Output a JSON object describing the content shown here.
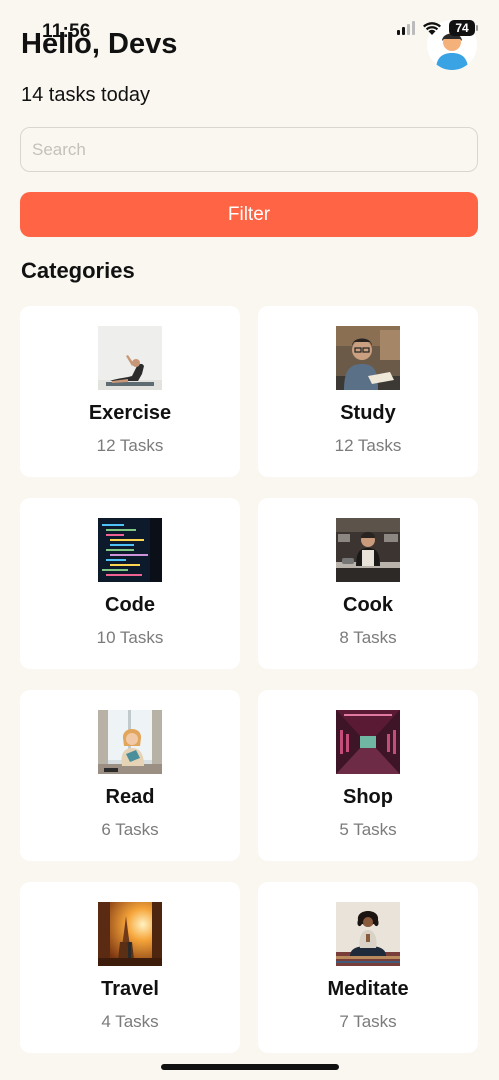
{
  "status_bar": {
    "time": "11:56",
    "battery": "74"
  },
  "header": {
    "greeting": "Hello, Devs",
    "subtitle": "14 tasks today"
  },
  "search": {
    "placeholder": "Search",
    "value": ""
  },
  "filter": {
    "label": "Filter",
    "color": "#ff6445"
  },
  "categories": {
    "title": "Categories",
    "items": [
      {
        "name": "Exercise",
        "count": "12 Tasks",
        "image": "yoga-stretch-photo"
      },
      {
        "name": "Study",
        "count": "12 Tasks",
        "image": "man-reading-book-photo"
      },
      {
        "name": "Code",
        "count": "10 Tasks",
        "image": "code-on-screen-photo"
      },
      {
        "name": "Cook",
        "count": "8 Tasks",
        "image": "chef-kitchen-photo"
      },
      {
        "name": "Read",
        "count": "6 Tasks",
        "image": "girl-reading-by-window-photo"
      },
      {
        "name": "Shop",
        "count": "5 Tasks",
        "image": "shop-interior-photo"
      },
      {
        "name": "Travel",
        "count": "4 Tasks",
        "image": "temple-sunset-photo"
      },
      {
        "name": "Meditate",
        "count": "7 Tasks",
        "image": "woman-meditating-photo"
      }
    ]
  }
}
